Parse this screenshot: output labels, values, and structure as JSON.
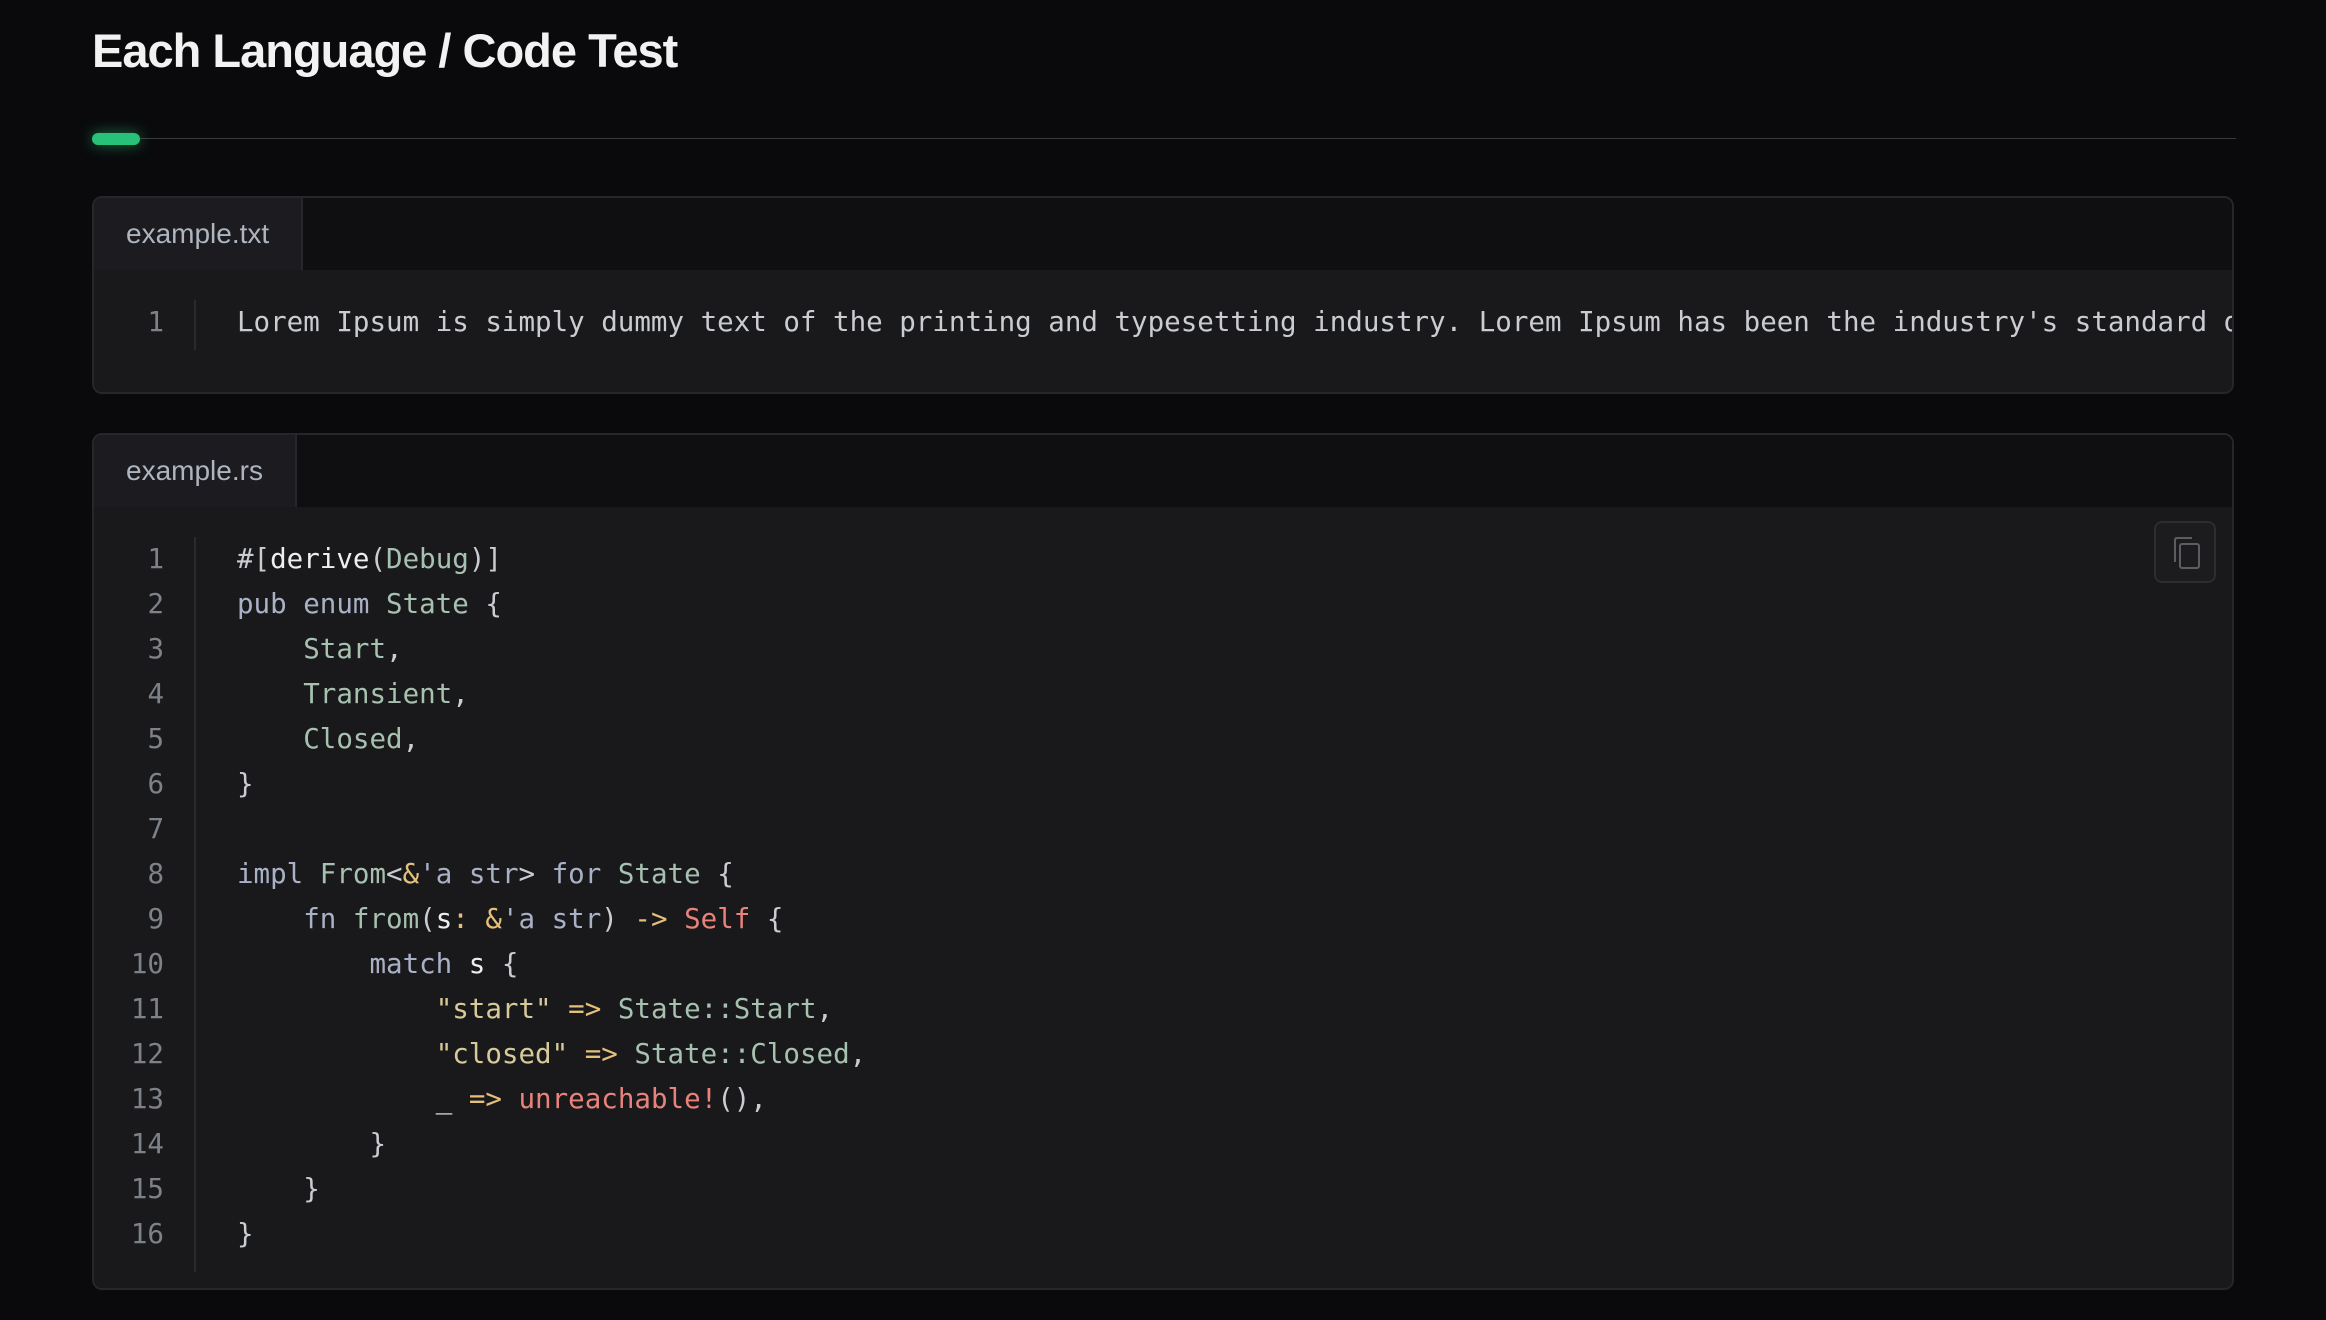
{
  "page": {
    "title": "Each Language / Code Test"
  },
  "colors": {
    "accent": "#27c177",
    "background": "#0a0a0c",
    "code_background": "#19191b"
  },
  "blocks": [
    {
      "filename": "example.txt",
      "lines": [
        {
          "number": "1",
          "tokens": [
            {
              "text": "Lorem Ipsum is simply dummy text of the printing and typesetting industry. Lorem Ipsum has been the industry's standard du",
              "kind": "plain"
            }
          ]
        }
      ]
    },
    {
      "filename": "example.rs",
      "copy_icon": "copy-icon",
      "lines": [
        {
          "number": "1",
          "tokens": [
            {
              "text": "#[",
              "kind": "punc"
            },
            {
              "text": "derive",
              "kind": "attr"
            },
            {
              "text": "(",
              "kind": "punc"
            },
            {
              "text": "Debug",
              "kind": "type"
            },
            {
              "text": ")]",
              "kind": "punc"
            }
          ]
        },
        {
          "number": "2",
          "tokens": [
            {
              "text": "pub enum ",
              "kind": "kw"
            },
            {
              "text": "State",
              "kind": "type"
            },
            {
              "text": " {",
              "kind": "punc"
            }
          ]
        },
        {
          "number": "3",
          "tokens": [
            {
              "text": "    Start",
              "kind": "type"
            },
            {
              "text": ",",
              "kind": "punc"
            }
          ]
        },
        {
          "number": "4",
          "tokens": [
            {
              "text": "    Transient",
              "kind": "type"
            },
            {
              "text": ",",
              "kind": "punc"
            }
          ]
        },
        {
          "number": "5",
          "tokens": [
            {
              "text": "    Closed",
              "kind": "type"
            },
            {
              "text": ",",
              "kind": "punc"
            }
          ]
        },
        {
          "number": "6",
          "tokens": [
            {
              "text": "}",
              "kind": "punc"
            }
          ]
        },
        {
          "number": "7",
          "tokens": []
        },
        {
          "number": "8",
          "tokens": [
            {
              "text": "impl ",
              "kind": "kw"
            },
            {
              "text": "From",
              "kind": "type"
            },
            {
              "text": "<",
              "kind": "punc"
            },
            {
              "text": "&",
              "kind": "op"
            },
            {
              "text": "'a str",
              "kind": "kw"
            },
            {
              "text": "> ",
              "kind": "punc"
            },
            {
              "text": "for ",
              "kind": "kw"
            },
            {
              "text": "State",
              "kind": "type"
            },
            {
              "text": " {",
              "kind": "punc"
            }
          ]
        },
        {
          "number": "9",
          "tokens": [
            {
              "text": "    fn ",
              "kind": "kw"
            },
            {
              "text": "from",
              "kind": "type"
            },
            {
              "text": "(",
              "kind": "punc"
            },
            {
              "text": "s",
              "kind": "var"
            },
            {
              "text": ": ",
              "kind": "op"
            },
            {
              "text": "&",
              "kind": "op"
            },
            {
              "text": "'a str",
              "kind": "kw"
            },
            {
              "text": ") ",
              "kind": "punc"
            },
            {
              "text": "->",
              "kind": "op"
            },
            {
              "text": " ",
              "kind": "plain"
            },
            {
              "text": "Self",
              "kind": "self"
            },
            {
              "text": " {",
              "kind": "punc"
            }
          ]
        },
        {
          "number": "10",
          "tokens": [
            {
              "text": "        match ",
              "kind": "kw"
            },
            {
              "text": "s",
              "kind": "var"
            },
            {
              "text": " {",
              "kind": "punc"
            }
          ]
        },
        {
          "number": "11",
          "tokens": [
            {
              "text": "            ",
              "kind": "plain"
            },
            {
              "text": "\"start\"",
              "kind": "str"
            },
            {
              "text": " ",
              "kind": "plain"
            },
            {
              "text": "=>",
              "kind": "op"
            },
            {
              "text": " ",
              "kind": "plain"
            },
            {
              "text": "State::Start",
              "kind": "type"
            },
            {
              "text": ",",
              "kind": "punc"
            }
          ]
        },
        {
          "number": "12",
          "tokens": [
            {
              "text": "            ",
              "kind": "plain"
            },
            {
              "text": "\"closed\"",
              "kind": "str"
            },
            {
              "text": " ",
              "kind": "plain"
            },
            {
              "text": "=>",
              "kind": "op"
            },
            {
              "text": " ",
              "kind": "plain"
            },
            {
              "text": "State::Closed",
              "kind": "type"
            },
            {
              "text": ",",
              "kind": "punc"
            }
          ]
        },
        {
          "number": "13",
          "tokens": [
            {
              "text": "            ",
              "kind": "plain"
            },
            {
              "text": "_",
              "kind": "var"
            },
            {
              "text": " ",
              "kind": "plain"
            },
            {
              "text": "=>",
              "kind": "op"
            },
            {
              "text": " ",
              "kind": "plain"
            },
            {
              "text": "unreachable!",
              "kind": "macro"
            },
            {
              "text": "(),",
              "kind": "punc"
            }
          ]
        },
        {
          "number": "14",
          "tokens": [
            {
              "text": "        }",
              "kind": "punc"
            }
          ]
        },
        {
          "number": "15",
          "tokens": [
            {
              "text": "    }",
              "kind": "punc"
            }
          ]
        },
        {
          "number": "16",
          "tokens": [
            {
              "text": "}",
              "kind": "punc"
            }
          ]
        }
      ]
    }
  ]
}
